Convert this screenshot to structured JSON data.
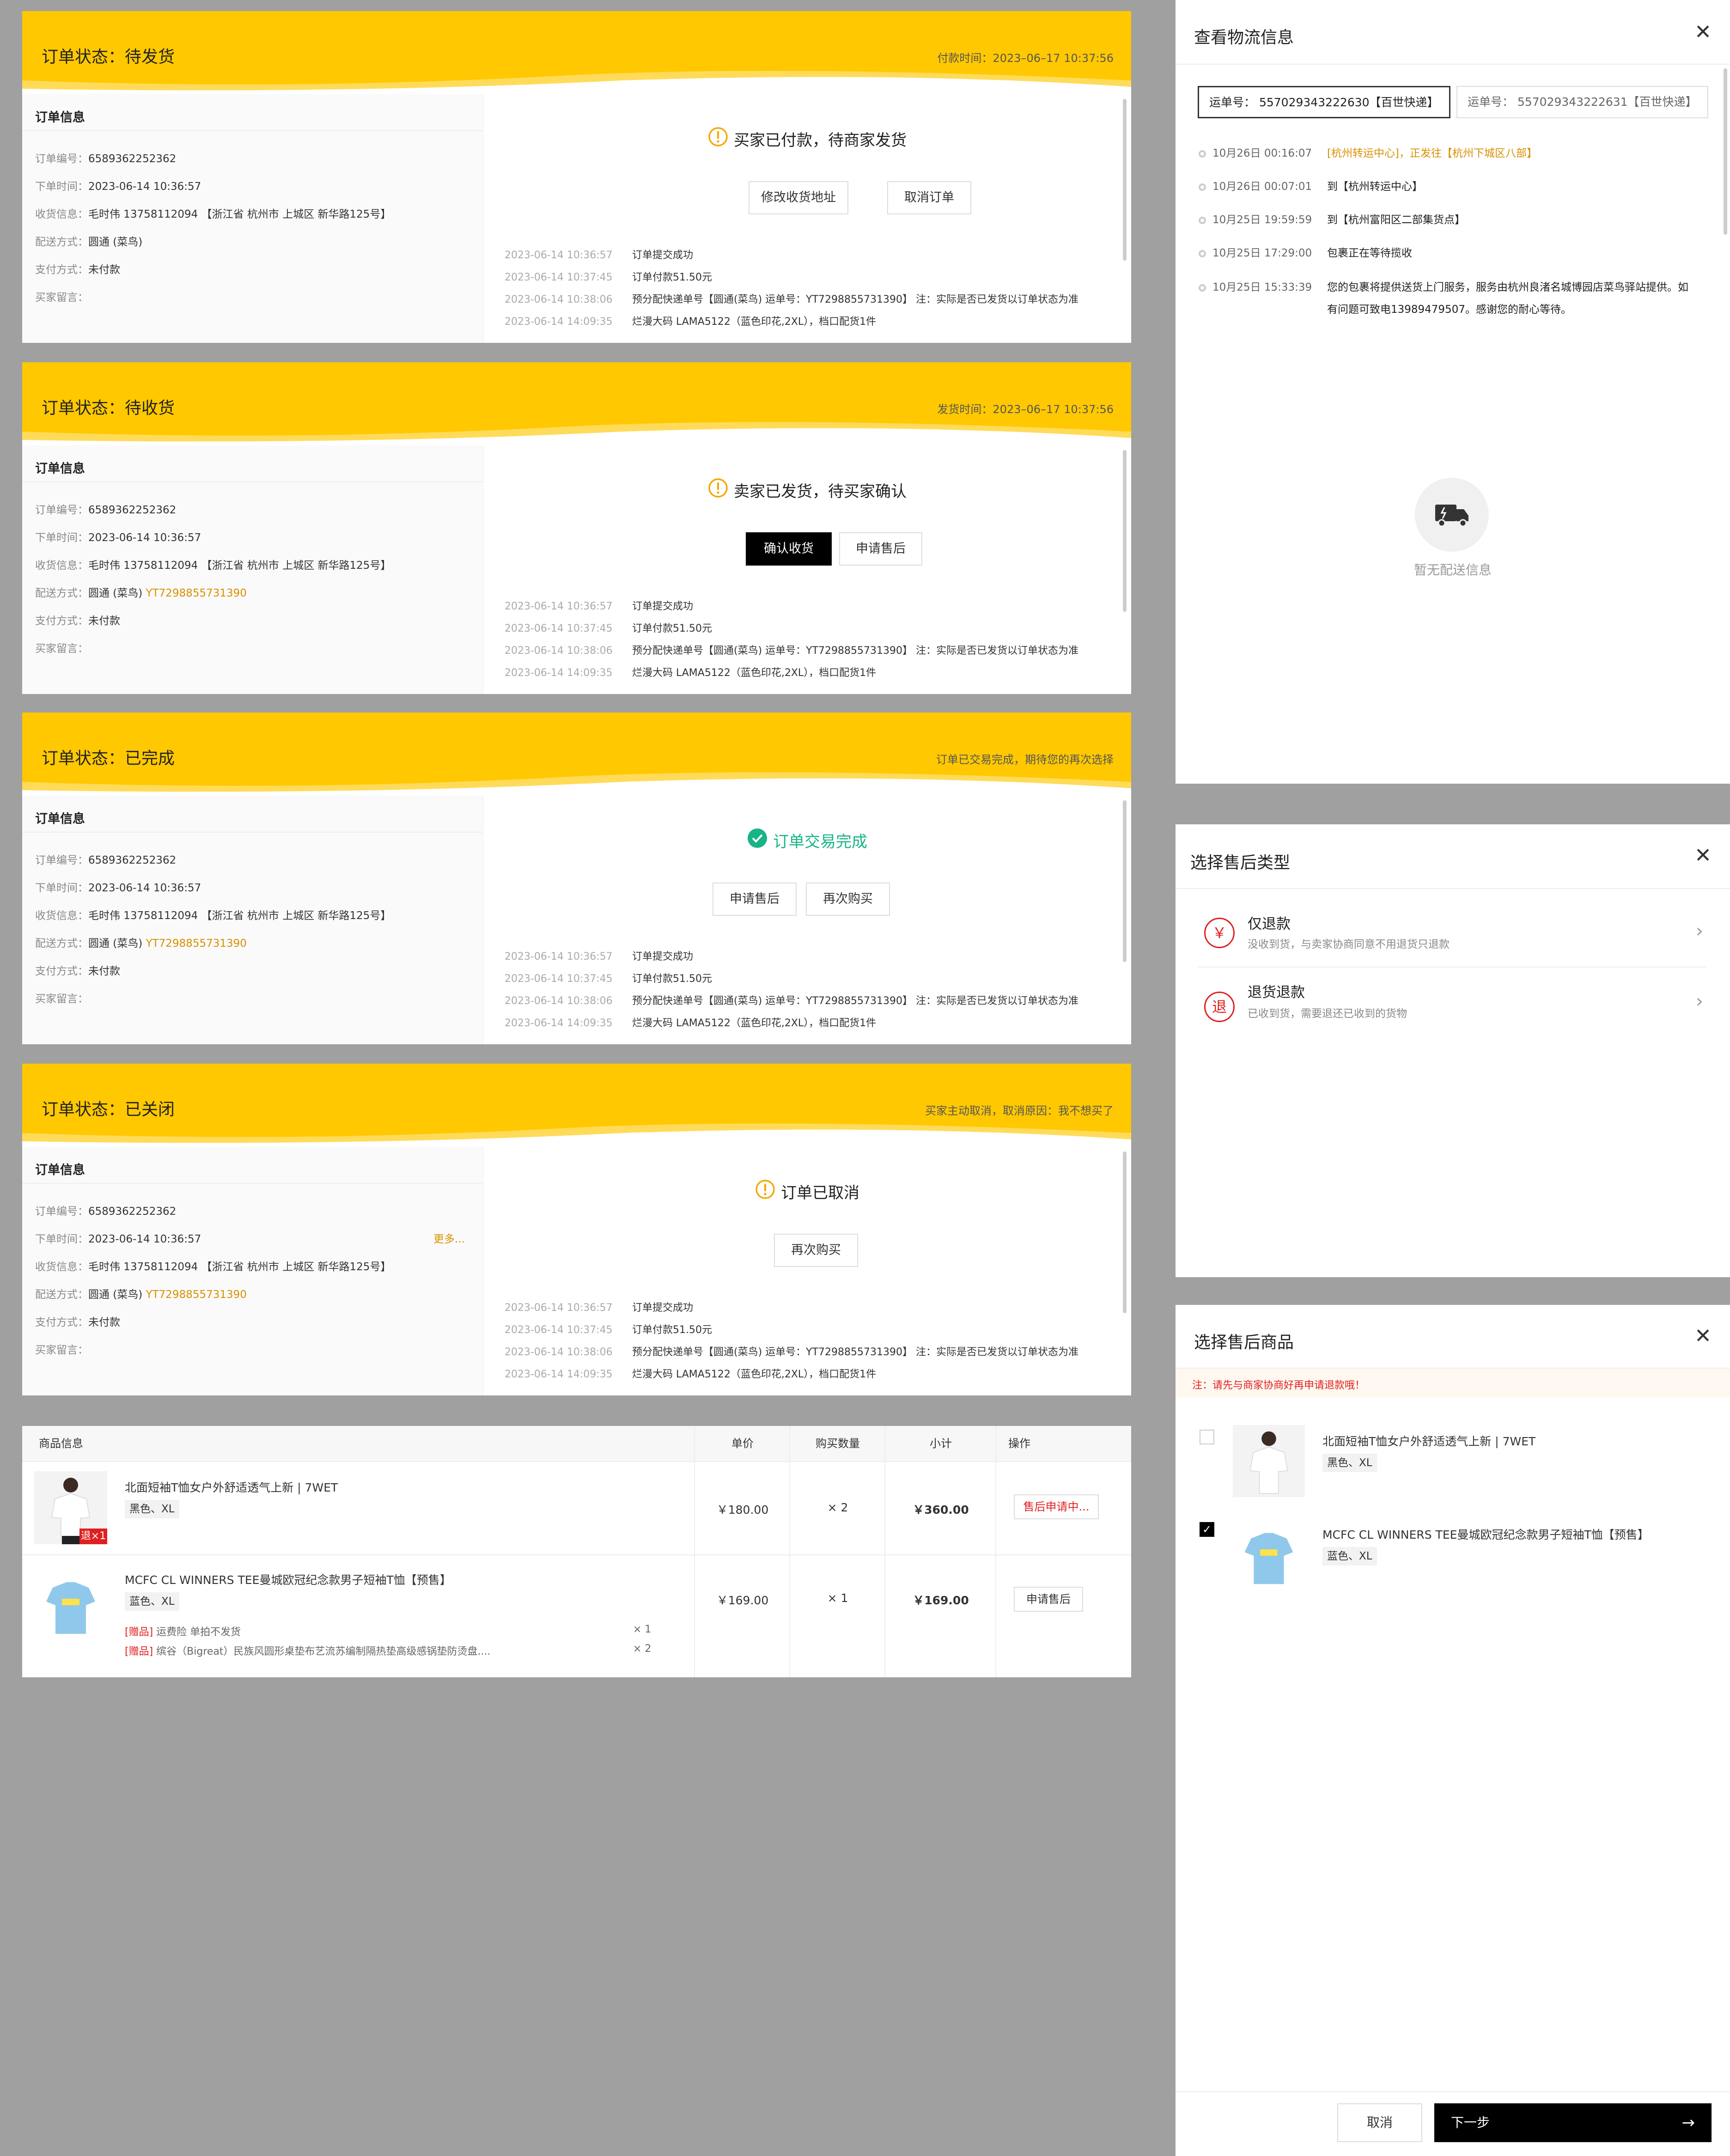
{
  "info_labels": {
    "title": "订单信息",
    "order_no": "订单编号：",
    "order_time": "下单时间：",
    "receiver": "收货信息：",
    "delivery": "配送方式：",
    "payment": "支付方式：",
    "message": "买家留言："
  },
  "order": {
    "no": "6589362252362",
    "time": "2023-06-14 10:36:57",
    "receiver": "毛时伟 13758112094 【浙江省 杭州市 上城区 新华路125号】",
    "courier": "圆通 (菜鸟)",
    "tracking": "YT7298855731390",
    "payment": "未付款"
  },
  "log": [
    {
      "time": "2023-06-14 10:36:57",
      "text": "订单提交成功"
    },
    {
      "time": "2023-06-14 10:37:45",
      "text": "订单付款51.50元"
    },
    {
      "time": "2023-06-14 10:38:06",
      "text": "预分配快递单号【圆通(菜鸟) 运单号：YT7298855731390】 注：实际是否已发货以订单状态为准"
    },
    {
      "time": "2023-06-14 14:09:35",
      "text": "烂漫大码 LAMA5122（蓝色印花,2XL），档口配货1件"
    }
  ],
  "cards": [
    {
      "status": "订单状态：待发货",
      "right": "付款时间：2023–06–17 10:37:56",
      "message": "买家已付款，待商家发货",
      "buttons": [
        "修改收货地址",
        "取消订单"
      ]
    },
    {
      "status": "订单状态：待收货",
      "right": "发货时间：2023–06–17 10:37:56",
      "message": "卖家已发货，待买家确认",
      "buttons": [
        "确认收货",
        "申请售后"
      ]
    },
    {
      "status": "订单状态：已完成",
      "right": "订单已交易完成，期待您的再次选择",
      "message": "订单交易完成",
      "buttons": [
        "申请售后",
        "再次购买"
      ]
    },
    {
      "status": "订单状态：已关闭",
      "right": "买家主动取消，取消原因：我不想买了",
      "message": "订单已取消",
      "buttons": [
        "再次购买"
      ],
      "more": "更多..."
    }
  ],
  "table": {
    "headers": [
      "商品信息",
      "单价",
      "购买数量",
      "小计",
      "操作"
    ],
    "rows": [
      {
        "name": "北面短袖T恤女户外舒适透气上新 | 7WET",
        "spec": "黑色、XL",
        "price": "￥180.00",
        "qty": "× 2",
        "subtotal": "￥360.00",
        "action": "售后申请中...",
        "badge": "退×1"
      },
      {
        "name": "MCFC CL WINNERS TEE曼城欧冠纪念款男子短袖T恤【预售】",
        "spec": "蓝色、XL",
        "price": "￥169.00",
        "qty": "× 1",
        "subtotal": "￥169.00",
        "action": "申请售后",
        "gifts": [
          {
            "tag": "[赠品]",
            "text": "运费险 单拍不发货",
            "qty": "× 1"
          },
          {
            "tag": "[赠品]",
            "text": "缤谷（Bigreat）民族风圆形桌垫布艺流苏编制隔热垫高级感锅垫防烫盘....",
            "qty": "× 2"
          }
        ]
      }
    ]
  },
  "logistics": {
    "title": "查看物流信息",
    "tabs": [
      {
        "label": "运单号：",
        "no": "557029343222630【百世快递】"
      },
      {
        "label": "运单号：",
        "no": "557029343222631【百世快递】"
      }
    ],
    "events": [
      {
        "time": "10月26日 00:16:07",
        "text": "[杭州转运中心]，正发往【杭州下城区八部】",
        "highlight": true
      },
      {
        "time": "10月26日 00:07:01",
        "text": "到【杭州转运中心】"
      },
      {
        "time": "10月25日 19:59:59",
        "text": "到【杭州富阳区二部集货点】"
      },
      {
        "time": "10月25日 17:29:00",
        "text": "包裹正在等待揽收"
      },
      {
        "time": "10月25日 15:33:39",
        "text": "您的包裹将提供送货上门服务，服务由杭州良渚名城博园店菜鸟驿站提供。如",
        "text2": "有问题可致电13989479507。感谢您的耐心等待。"
      }
    ],
    "empty": "暂无配送信息"
  },
  "aftersale_type": {
    "title": "选择售后类型",
    "options": [
      {
        "icon": "￥",
        "title": "仅退款",
        "desc": "没收到货，与卖家协商同意不用退货只退款"
      },
      {
        "icon": "退",
        "title": "退货退款",
        "desc": "已收到货，需要退还已收到的货物"
      }
    ]
  },
  "aftersale_goods": {
    "title": "选择售后商品",
    "notice": "注：请先与商家协商好再申请退款哦！",
    "items": [
      {
        "name": "北面短袖T恤女户外舒适透气上新 | 7WET",
        "spec": "黑色、XL",
        "checked": false
      },
      {
        "name": "MCFC CL WINNERS TEE曼城欧冠纪念款男子短袖T恤【预售】",
        "spec": "蓝色、XL",
        "checked": true
      }
    ],
    "cancel": "取消",
    "next": "下一步",
    "next_arrow": "→"
  },
  "icons": {
    "warning": "warning-icon",
    "check": "check-circle-icon",
    "close": "close-icon",
    "chevron": "chevron-right-icon",
    "truck": "truck-icon"
  },
  "colors": {
    "header": "#ffc800",
    "accent": "#d89000",
    "success": "#19b388",
    "danger": "#e02020"
  }
}
